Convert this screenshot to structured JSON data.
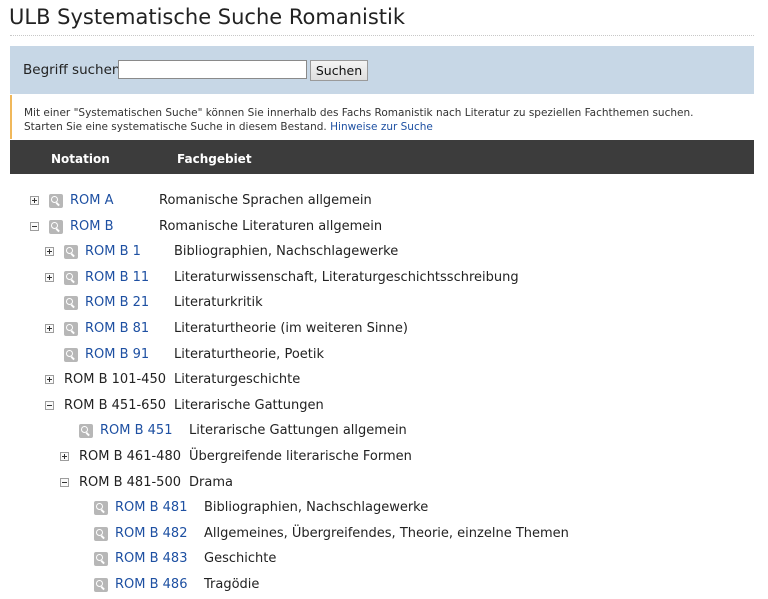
{
  "page": {
    "title": "ULB Systematische Suche Romanistik"
  },
  "search": {
    "label": "Begriff suchen",
    "value": "",
    "placeholder": "",
    "button_label": "Suchen"
  },
  "info": {
    "line1": "Mit einer \"Systematischen Suche\" können Sie innerhalb des Fachs Romanistik nach Literatur zu speziellen Fachthemen suchen.",
    "line2_text": "Starten Sie eine systematische Suche in diesem Bestand.",
    "line2_link": "Hinweise zur Suche"
  },
  "table": {
    "col_notation": "Notation",
    "col_fachgebiet": "Fachgebiet"
  },
  "tree": [
    {
      "depth": 0,
      "toggle": "plus",
      "search": true,
      "notation": "ROM A",
      "label": "Romanische Sprachen allgemein"
    },
    {
      "depth": 0,
      "toggle": "minus",
      "search": true,
      "notation": "ROM B",
      "label": "Romanische Literaturen allgemein"
    },
    {
      "depth": 1,
      "toggle": "plus",
      "search": true,
      "notation": "ROM B 1",
      "label": "Bibliographien, Nachschlagewerke"
    },
    {
      "depth": 1,
      "toggle": "plus",
      "search": true,
      "notation": "ROM B 11",
      "label": "Literaturwissenschaft, Literaturgeschichtsschreibung"
    },
    {
      "depth": 1,
      "toggle": "none",
      "search": true,
      "notation": "ROM B 21",
      "label": "Literaturkritik"
    },
    {
      "depth": 1,
      "toggle": "plus",
      "search": true,
      "notation": "ROM B 81",
      "label": "Literaturtheorie (im weiteren Sinne)"
    },
    {
      "depth": 1,
      "toggle": "none",
      "search": true,
      "notation": "ROM B 91",
      "label": "Literaturtheorie, Poetik"
    },
    {
      "depth": 1,
      "toggle": "plus",
      "search": false,
      "notation": "ROM B 101-450",
      "label": "Literaturgeschichte"
    },
    {
      "depth": 1,
      "toggle": "minus",
      "search": false,
      "notation": "ROM B 451-650",
      "label": "Literarische Gattungen"
    },
    {
      "depth": 2,
      "toggle": "none",
      "search": true,
      "notation": "ROM B 451",
      "label": "Literarische Gattungen allgemein"
    },
    {
      "depth": 2,
      "toggle": "plus",
      "search": false,
      "notation": "ROM B 461-480",
      "label": "Übergreifende literarische Formen"
    },
    {
      "depth": 2,
      "toggle": "minus",
      "search": false,
      "notation": "ROM B 481-500",
      "label": "Drama"
    },
    {
      "depth": 3,
      "toggle": "none",
      "search": true,
      "notation": "ROM B 481",
      "label": "Bibliographien, Nachschlagewerke"
    },
    {
      "depth": 3,
      "toggle": "none",
      "search": true,
      "notation": "ROM B 482",
      "label": "Allgemeines, Übergreifendes, Theorie, einzelne Themen"
    },
    {
      "depth": 3,
      "toggle": "none",
      "search": true,
      "notation": "ROM B 483",
      "label": "Geschichte"
    },
    {
      "depth": 3,
      "toggle": "none",
      "search": true,
      "notation": "ROM B 486",
      "label": "Tragödie"
    }
  ]
}
